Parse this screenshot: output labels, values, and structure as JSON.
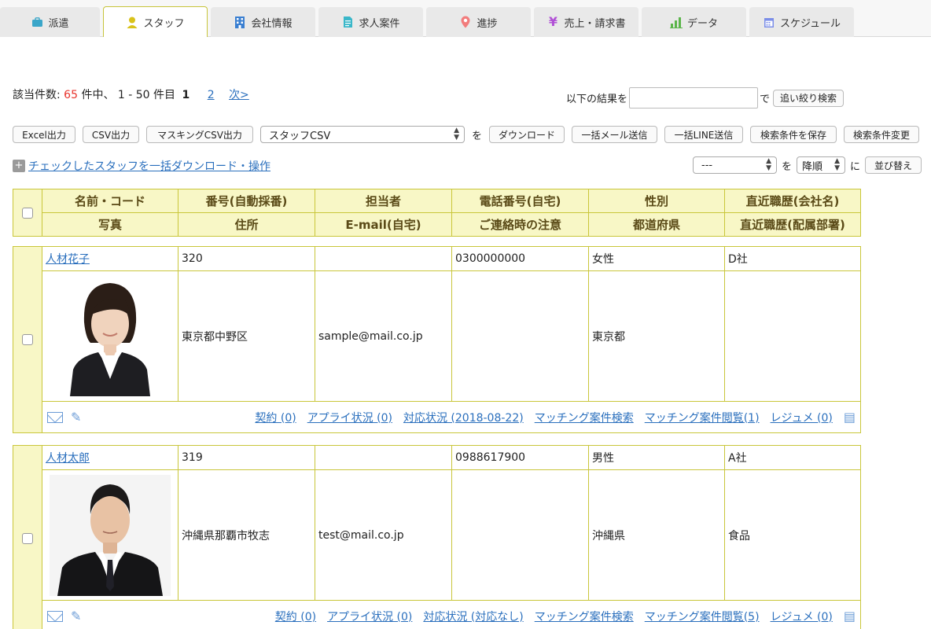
{
  "tabs": [
    {
      "label": "派遣",
      "icon": "briefcase-icon",
      "color": "#3aa6c9"
    },
    {
      "label": "スタッフ",
      "icon": "person-icon",
      "color": "#d9c21a"
    },
    {
      "label": "会社情報",
      "icon": "building-icon",
      "color": "#3a7fd1"
    },
    {
      "label": "求人案件",
      "icon": "document-icon",
      "color": "#3ab7c9"
    },
    {
      "label": "進捗",
      "icon": "map-pin-icon",
      "color": "#f27c7c"
    },
    {
      "label": "売上・請求書",
      "icon": "yen-icon",
      "color": "#b04fd6"
    },
    {
      "label": "データ",
      "icon": "bar-chart-icon",
      "color": "#5bb54a"
    },
    {
      "label": "スケジュール",
      "icon": "calendar-icon",
      "color": "#7b8ee8"
    }
  ],
  "results": {
    "prefix": "該当件数:",
    "total": "65",
    "middle": "件中、 1 - 50 件目",
    "current_page": "1",
    "page2": "2",
    "next": "次>"
  },
  "refine": {
    "label_before": "以下の結果を",
    "input_value": "",
    "label_after": "で",
    "button": "追い絞り検索"
  },
  "toolbar": {
    "excel": "Excel出力",
    "csv": "CSV出力",
    "masking_csv": "マスキングCSV出力",
    "select_value": "スタッフCSV",
    "wo": "を",
    "download": "ダウンロード",
    "bulk_mail": "一括メール送信",
    "bulk_line": "一括LINE送信",
    "save_cond": "検索条件を保存",
    "change_cond": "検索条件変更"
  },
  "bulk_action": {
    "label": "チェックしたスタッフを一括ダウンロード・操作"
  },
  "sort": {
    "field_value": "---",
    "wo": "を",
    "order_value": "降順",
    "ni": "に",
    "button": "並び替え"
  },
  "header": {
    "row1": [
      "名前・コード",
      "番号(自動採番)",
      "担当者",
      "電話番号(自宅)",
      "性別",
      "直近職歴(会社名)"
    ],
    "row2": [
      "写真",
      "住所",
      "E-mail(自宅)",
      "ご連絡時の注意",
      "都道府県",
      "直近職歴(配属部署)"
    ]
  },
  "staff": [
    {
      "name": "人材花子",
      "number": "320",
      "manager": "",
      "phone": "0300000000",
      "gender": "女性",
      "company": "D社",
      "address": "東京都中野区",
      "email": "sample@mail.co.jp",
      "note": "",
      "prefecture": "東京都",
      "department": "",
      "links": [
        "契約 (0)",
        "アプライ状況 (0)",
        "対応状況 (2018-08-22)",
        "マッチング案件検索",
        "マッチング案件閲覧(1)",
        "レジュメ (0)"
      ]
    },
    {
      "name": "人材太郎",
      "number": "319",
      "manager": "",
      "phone": "0988617900",
      "gender": "男性",
      "company": "A社",
      "address": "沖縄県那覇市牧志",
      "email": "test@mail.co.jp",
      "note": "",
      "prefecture": "沖縄県",
      "department": "食品",
      "links": [
        "契約 (0)",
        "アプライ状況 (0)",
        "対応状況 (対応なし)",
        "マッチング案件検索",
        "マッチング案件閲覧(5)",
        "レジュメ (0)"
      ]
    }
  ],
  "colors": {
    "accent_border": "#c9c63a",
    "header_bg": "#f8f7c6",
    "link": "#2a6fbd",
    "count_red": "#e8332c"
  }
}
